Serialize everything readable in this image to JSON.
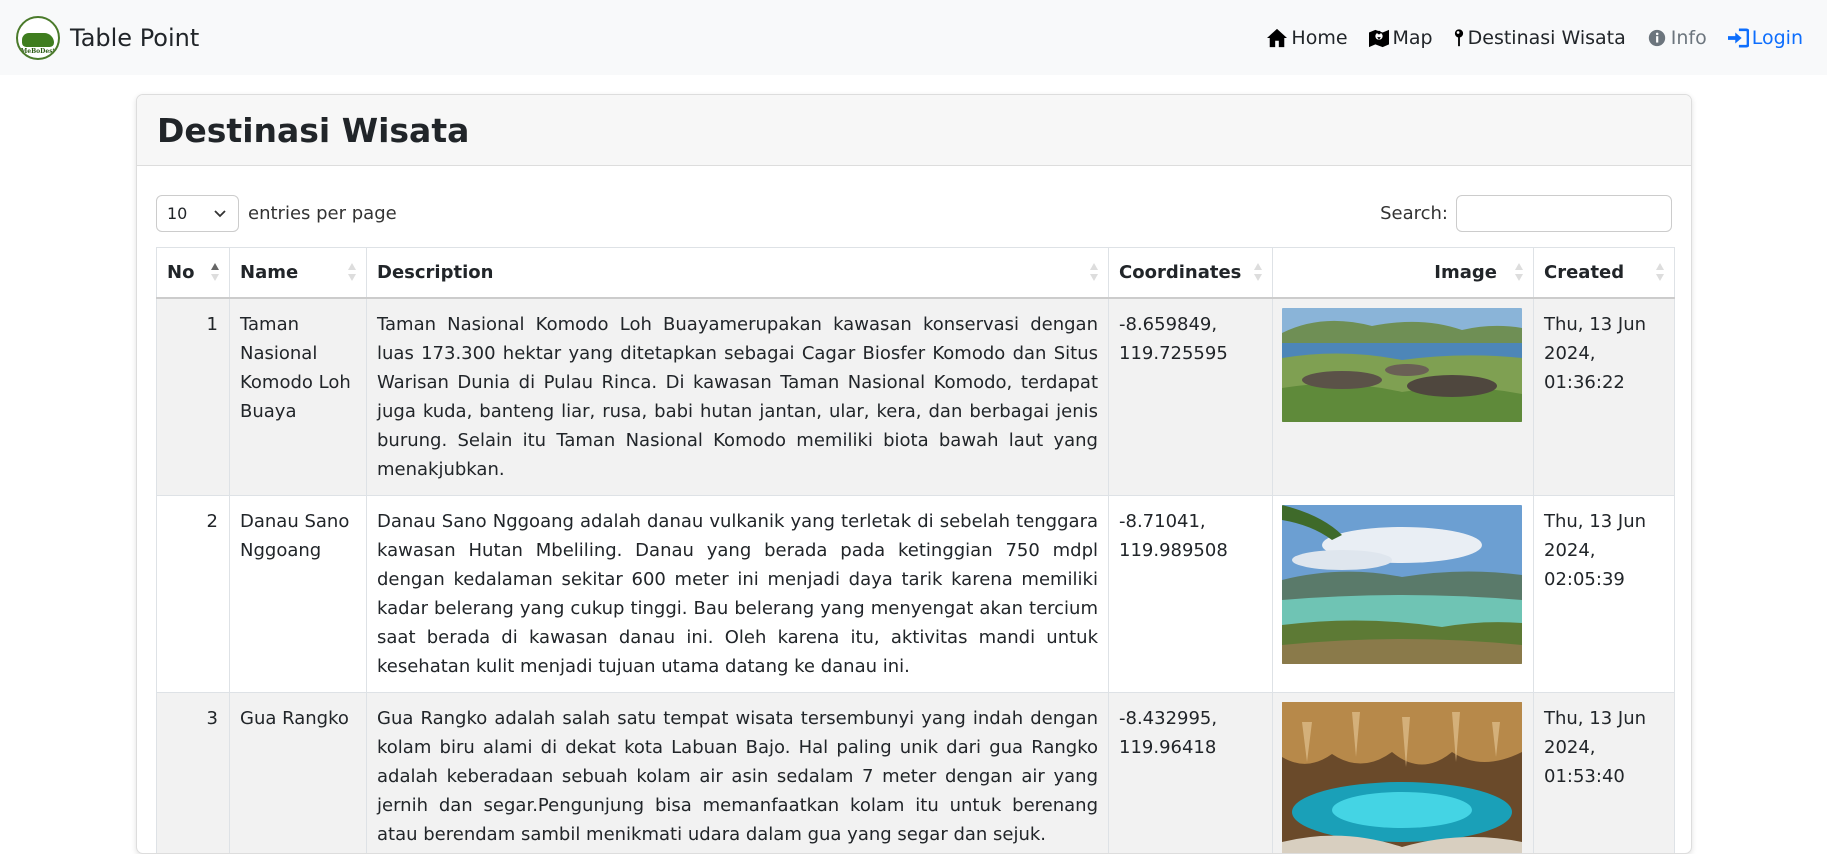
{
  "navbar": {
    "brand": "Table Point",
    "logo_text": "MeBoDest",
    "items": [
      {
        "label": "Home",
        "icon": "home-icon"
      },
      {
        "label": "Map",
        "icon": "map-icon"
      },
      {
        "label": "Destinasi Wisata",
        "icon": "pin-icon"
      },
      {
        "label": "Info",
        "icon": "info-icon"
      },
      {
        "label": "Login",
        "icon": "login-icon"
      }
    ],
    "colors": {
      "muted": "#6c757d",
      "primary": "#0d6efd"
    }
  },
  "page": {
    "title": "Destinasi Wisata"
  },
  "table_controls": {
    "per_page_value": "10",
    "per_page_label": "entries per page",
    "search_label": "Search:"
  },
  "table": {
    "columns": [
      "No",
      "Name",
      "Description",
      "Coordinates",
      "Image",
      "Created"
    ],
    "rows": [
      {
        "no": "1",
        "name": "Taman Nasional Komodo Loh Buaya",
        "description": "Taman Nasional Komodo Loh Buayamerupakan kawasan konservasi dengan luas 173.300 hektar yang ditetapkan sebagai Cagar Biosfer Komodo dan Situs Warisan Dunia di Pulau Rinca. Di kawasan Taman Nasional Komodo, terdapat juga kuda, banteng liar, rusa, babi hutan jantan, ular, kera, dan berbagai jenis burung. Selain itu Taman Nasional Komodo memiliki biota bawah laut yang menakjubkan.",
        "coordinates": "-8.659849, 119.725595",
        "created": "Thu, 13 Jun 2024, 01:36:22"
      },
      {
        "no": "2",
        "name": "Danau Sano Nggoang",
        "description": "Danau Sano Nggoang adalah danau vulkanik yang terletak di sebelah tenggara kawasan Hutan Mbeliling. Danau yang berada pada ketinggian 750 mdpl dengan kedalaman sekitar 600 meter ini menjadi daya tarik karena memiliki kadar belerang yang cukup tinggi. Bau belerang yang menyengat akan tercium saat berada di kawasan danau ini. Oleh karena itu, aktivitas mandi untuk kesehatan kulit menjadi tujuan utama datang ke danau ini.",
        "coordinates": "-8.71041, 119.989508",
        "created": "Thu, 13 Jun 2024, 02:05:39"
      },
      {
        "no": "3",
        "name": "Gua Rangko",
        "description": "Gua Rangko adalah salah satu tempat wisata tersembunyi yang indah dengan kolam biru alami di dekat kota Labuan Bajo. Hal paling unik dari gua Rangko adalah keberadaan sebuah kolam air asin sedalam 7 meter dengan air yang jernih dan segar.Pengunjung bisa memanfaatkan kolam itu untuk berenang atau berendam sambil menikmati udara dalam gua yang segar dan sejuk.",
        "coordinates": "-8.432995, 119.96418",
        "created": "Thu, 13 Jun 2024, 01:53:40"
      }
    ]
  }
}
